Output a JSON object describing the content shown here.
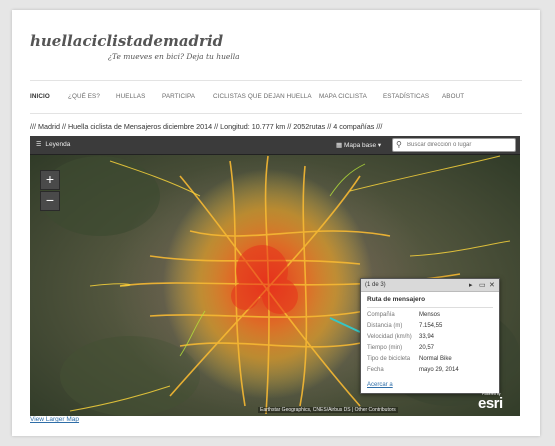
{
  "site": {
    "title": "huellaciclistademadrid",
    "tagline": "¿Te mueves en bici? Deja tu huella"
  },
  "nav": {
    "items": [
      {
        "label": "INICIO",
        "active": true
      },
      {
        "label": "¿QUÉ ES?"
      },
      {
        "label": "HUELLAS"
      },
      {
        "label": "PARTICIPA"
      },
      {
        "label": "CICLISTAS QUE DEJAN HUELLA"
      },
      {
        "label": "MAPA CICLISTA"
      },
      {
        "label": "ESTADÍSTICAS"
      },
      {
        "label": "ABOUT"
      }
    ]
  },
  "info_line": "/// Madrid // Huella ciclista de Mensajeros diciembre 2014 // Longitud: 10.777 km // 2052rutas // 4 compañías ///",
  "map": {
    "toolbar": {
      "legend_label": "Leyenda",
      "basemap_label": "Mapa base",
      "search_placeholder": "Buscar dirección o lugar"
    },
    "zoom": {
      "in": "+",
      "out": "−"
    },
    "popup": {
      "count": "(1 de 3)",
      "title": "Ruta de mensajero",
      "rows": [
        {
          "label": "Compañía",
          "value": "Mensos"
        },
        {
          "label": "Distancia (m)",
          "value": "7.154,55"
        },
        {
          "label": "Velocidad (km/h)",
          "value": "33,94"
        },
        {
          "label": "Tiempo (min)",
          "value": "20,57"
        },
        {
          "label": "Tipo de bicicleta",
          "value": "Normal Bike"
        },
        {
          "label": "Fecha",
          "value": "mayo 29, 2014"
        }
      ],
      "zoom_link": "Acercar a"
    },
    "attribution": "Earthstar Geographics, CNES/Airbus DS | Other Contributors",
    "esri_powered": "Powered by",
    "esri_logo": "esri",
    "colors": {
      "routes_dense": "#e8321b",
      "routes_mid": "#f39a1d",
      "routes_light": "#f7d23b",
      "routes_sparse": "#b6e33a"
    }
  },
  "footer": {
    "larger_map_link": "View Larger Map"
  }
}
